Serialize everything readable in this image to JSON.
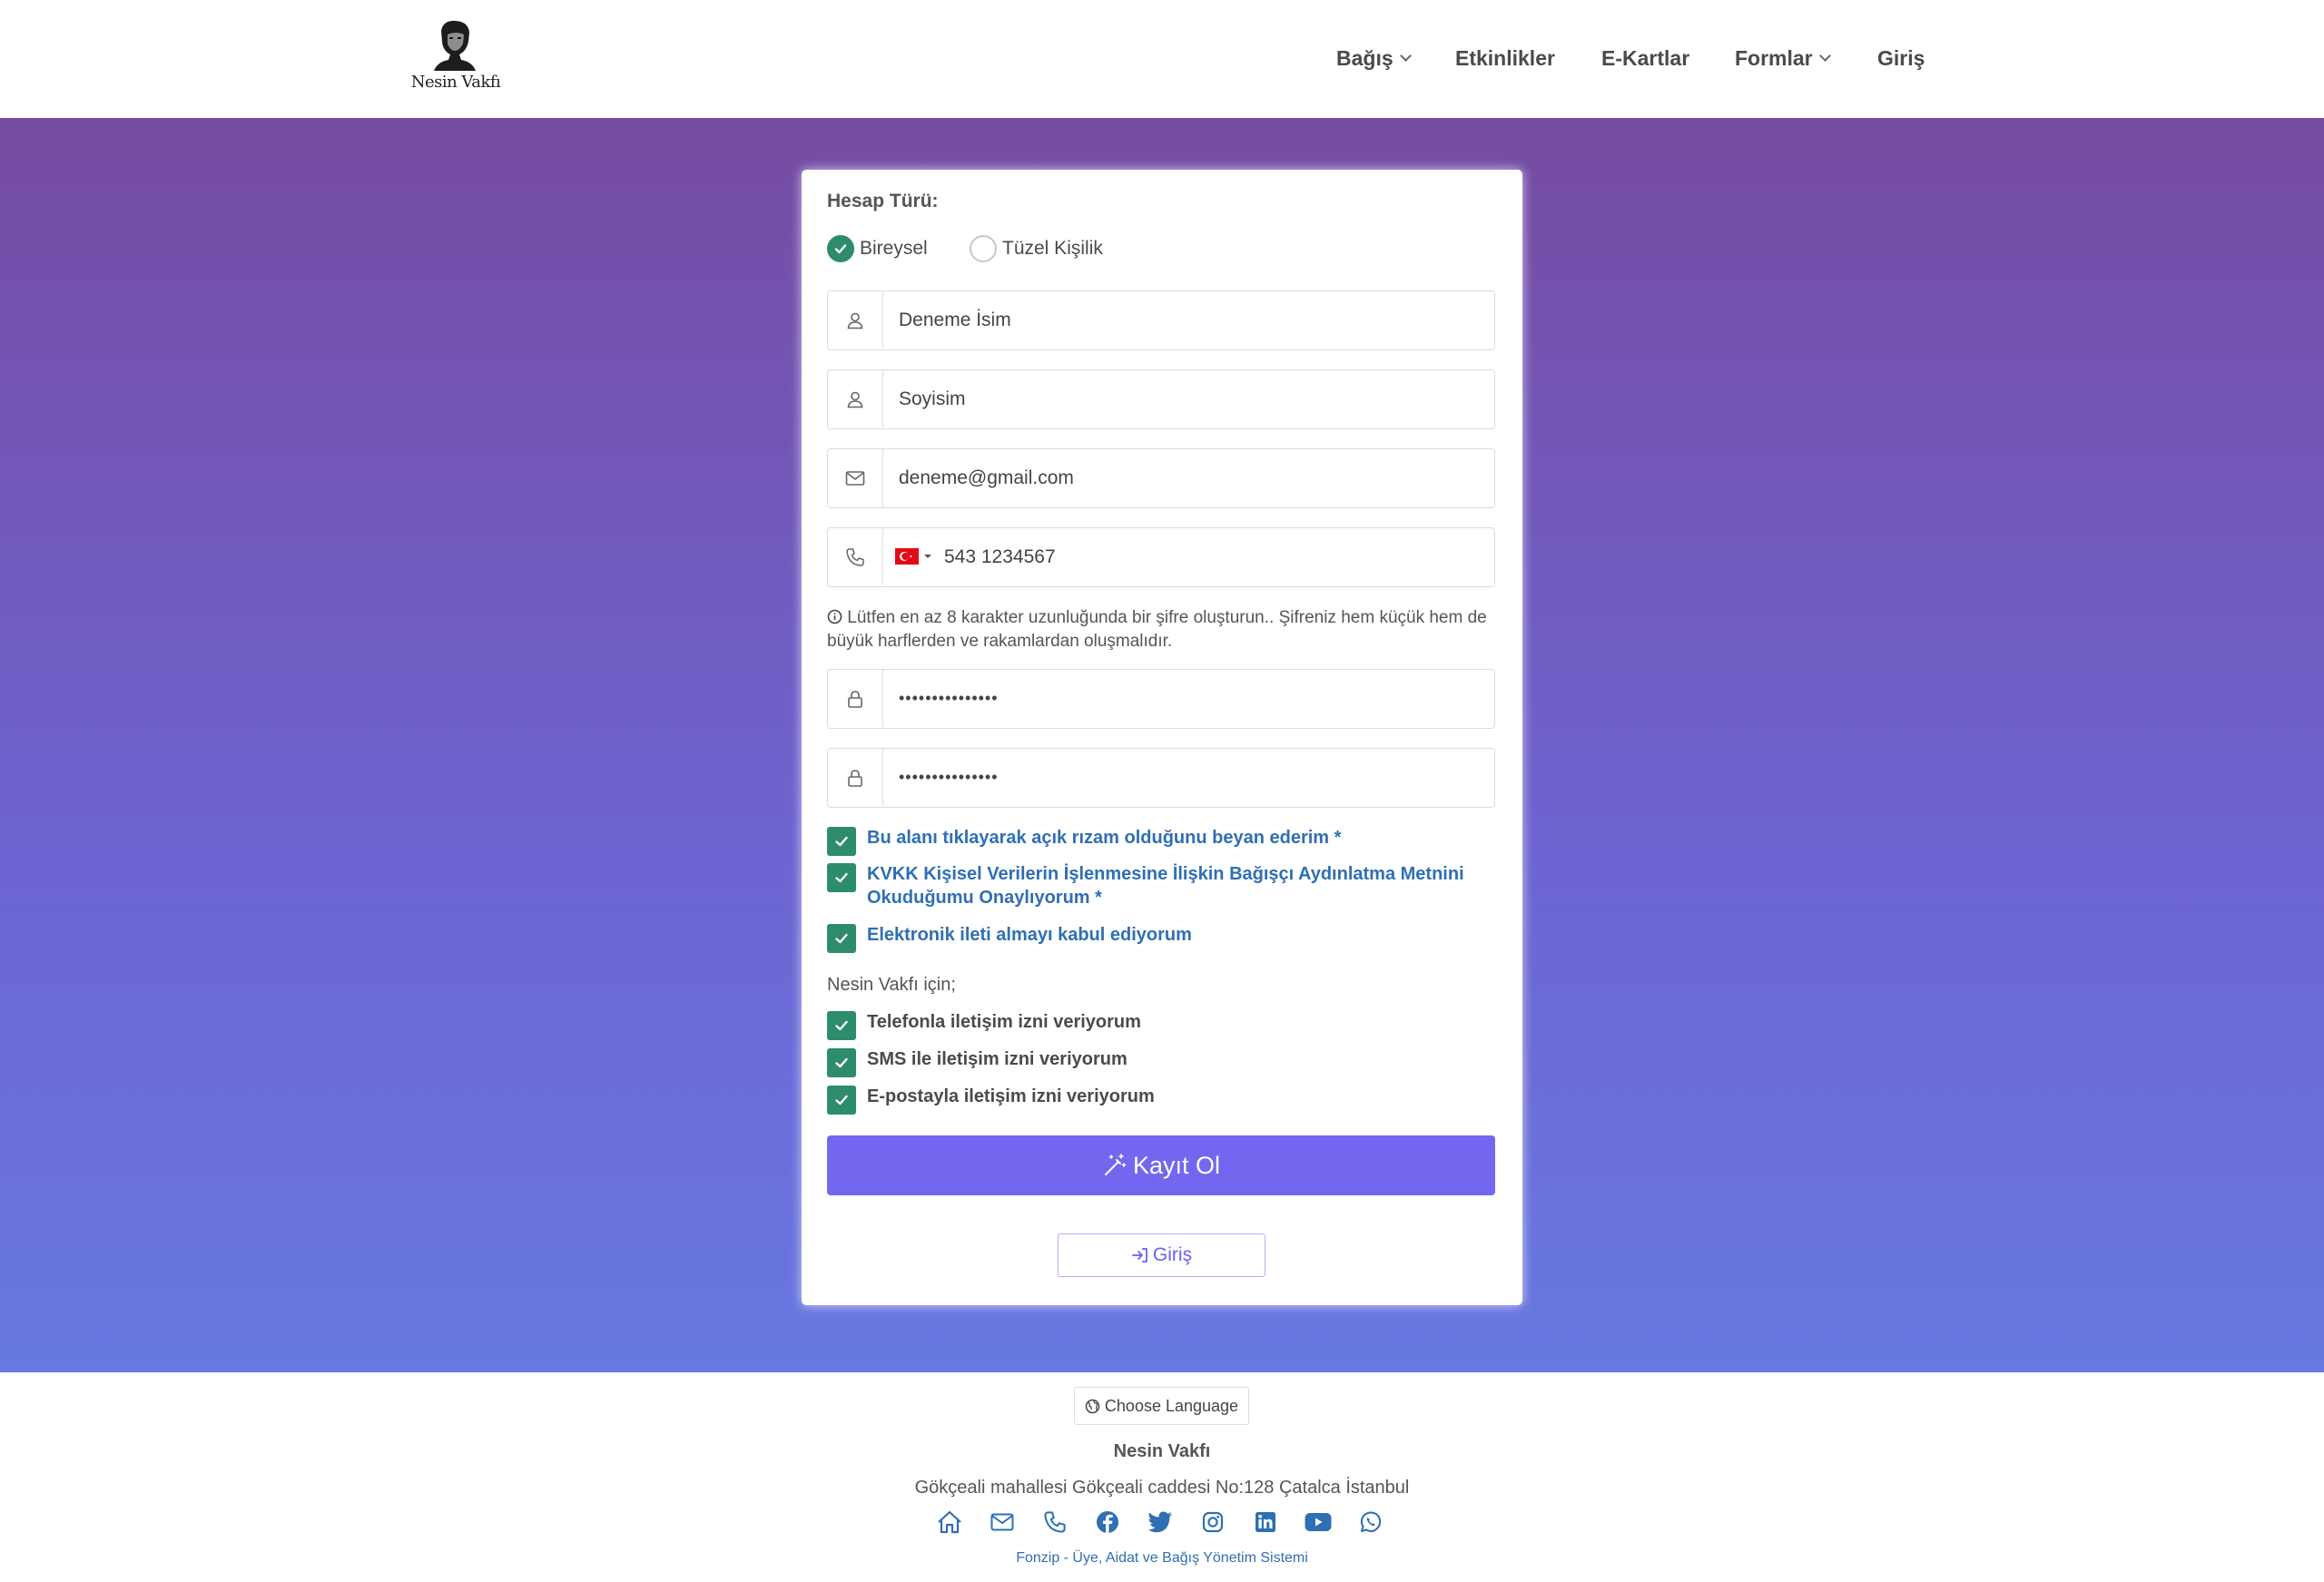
{
  "header": {
    "logo_text": "Nesin Vakfı",
    "nav": [
      {
        "label": "Bağış",
        "has_dropdown": true
      },
      {
        "label": "Etkinlikler",
        "has_dropdown": false
      },
      {
        "label": "E-Kartlar",
        "has_dropdown": false
      },
      {
        "label": "Formlar",
        "has_dropdown": true
      },
      {
        "label": "Giriş",
        "has_dropdown": false
      }
    ]
  },
  "form": {
    "account_type_label": "Hesap Türü:",
    "account_types": [
      {
        "label": "Bireysel",
        "selected": true
      },
      {
        "label": "Tüzel Kişilik",
        "selected": false
      }
    ],
    "first_name": "Deneme İsim",
    "last_name_placeholder": "Soyisim",
    "email": "deneme@gmail.com",
    "phone": "543 1234567",
    "phone_country": "TR",
    "password_hint": "Lütfen en az 8 karakter uzunluğunda bir şifre oluşturun.. Şifreniz hem küçük hem de büyük harflerden ve rakamlardan oluşmalıdır.",
    "password": "•••••••••••••••",
    "password_confirm": "•••••••••••••••",
    "consents": [
      {
        "label": "Bu alanı tıklayarak açık rızam olduğunu beyan ederim *",
        "checked": true
      },
      {
        "label": "KVKK Kişisel Verilerin İşlenmesine İlişkin Bağışçı Aydınlatma Metnini Okuduğumu Onaylıyorum *",
        "checked": true
      },
      {
        "label": "Elektronik ileti almayı kabul ediyorum",
        "checked": true
      }
    ],
    "contact_section_label": "Nesin Vakfı için;",
    "contact_permissions": [
      {
        "label": "Telefonla iletişim izni veriyorum",
        "checked": true
      },
      {
        "label": "SMS ile iletişim izni veriyorum",
        "checked": true
      },
      {
        "label": "E-postayla iletişim izni veriyorum",
        "checked": true
      }
    ],
    "register_button": "Kayıt Ol",
    "login_button": "Giriş"
  },
  "footer": {
    "language_button": "Choose Language",
    "org_name": "Nesin Vakfı",
    "address": "Gökçeali mahallesi Gökçeali caddesi No:128 Çatalca İstanbul",
    "social_icons": [
      "home-icon",
      "mail-icon",
      "phone-icon",
      "facebook-icon",
      "twitter-icon",
      "instagram-icon",
      "linkedin-icon",
      "youtube-icon",
      "whatsapp-icon"
    ],
    "credit": "Fonzip - Üye, Aidat ve Bağış Yönetim Sistemi"
  },
  "colors": {
    "accent_purple": "#7367f0",
    "check_green": "#2d8b6e",
    "link_blue": "#2f6fb3",
    "band_top": "#764ba2",
    "band_bottom": "#6778e1"
  }
}
